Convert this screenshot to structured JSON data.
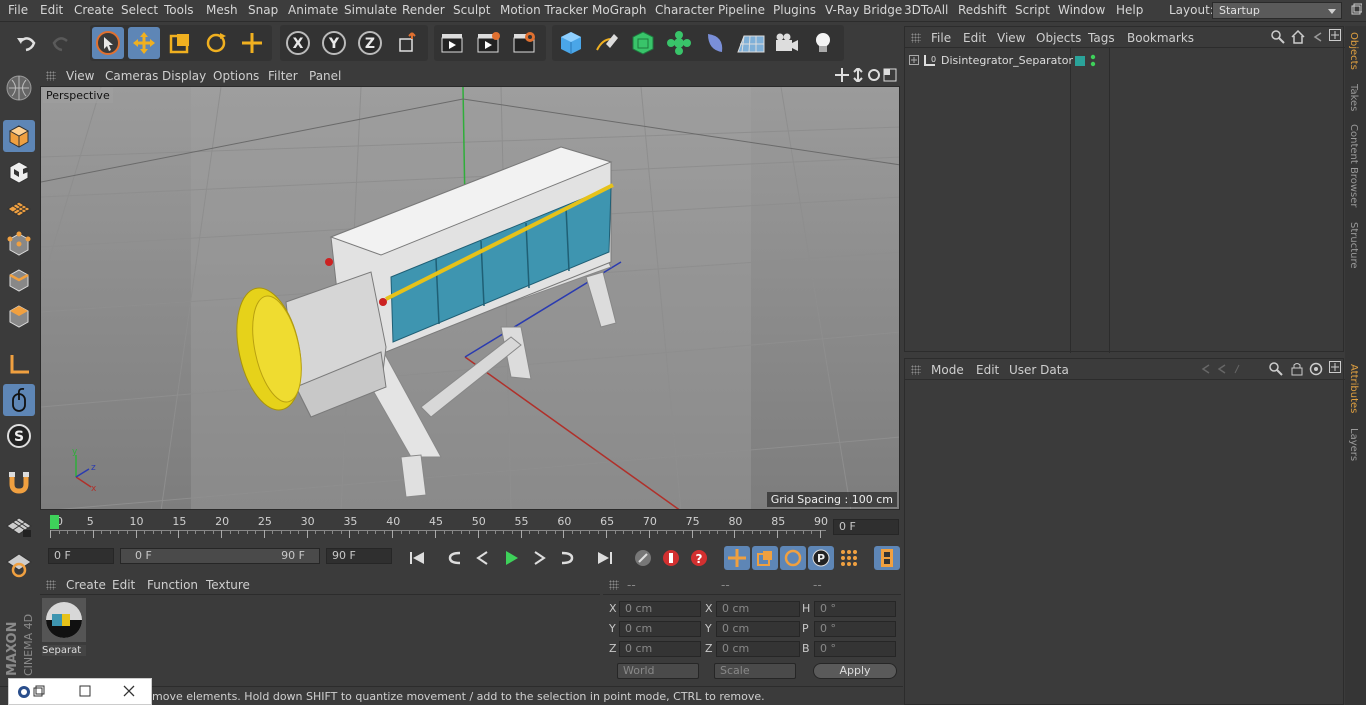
{
  "menubar": {
    "items": [
      "File",
      "Edit",
      "Create",
      "Select",
      "Tools",
      "Mesh",
      "Snap",
      "Animate",
      "Simulate",
      "Render",
      "Sculpt",
      "Motion Tracker",
      "MoGraph",
      "Character",
      "Pipeline",
      "Plugins",
      "V-Ray Bridge",
      "3DToAll",
      "Redshift",
      "Script",
      "Window",
      "Help"
    ],
    "layout_label": "Layout:",
    "layout_value": "Startup"
  },
  "viewport": {
    "menu": [
      "View",
      "Cameras",
      "Display",
      "Options",
      "Filter",
      "Panel"
    ],
    "label": "Perspective",
    "grid_spacing": "Grid Spacing : 100 cm"
  },
  "timeline": {
    "ticks": [
      "0",
      "5",
      "10",
      "15",
      "20",
      "25",
      "30",
      "35",
      "40",
      "45",
      "50",
      "55",
      "60",
      "65",
      "70",
      "75",
      "80",
      "85",
      "90"
    ],
    "current_frame": "0 F"
  },
  "transport": {
    "start_field": "0 F",
    "range_start": "0 F",
    "range_end": "90 F",
    "end_field": "90 F"
  },
  "material_panel": {
    "menu": [
      "Create",
      "Edit",
      "Function",
      "Texture"
    ],
    "material_name": "Separat"
  },
  "coords": {
    "headers": [
      "--",
      "--",
      "--"
    ],
    "rows": [
      {
        "a": "X",
        "av": "0 cm",
        "b": "X",
        "bv": "0 cm",
        "c": "H",
        "cv": "0 °"
      },
      {
        "a": "Y",
        "av": "0 cm",
        "b": "Y",
        "bv": "0 cm",
        "c": "P",
        "cv": "0 °"
      },
      {
        "a": "Z",
        "av": "0 cm",
        "b": "Z",
        "bv": "0 cm",
        "c": "B",
        "cv": "0 °"
      }
    ],
    "world": "World",
    "scale": "Scale",
    "apply": "Apply"
  },
  "status": {
    "text": "move elements. Hold down SHIFT to quantize movement / add to the selection in point mode, CTRL to remove."
  },
  "object_manager": {
    "menu": [
      "File",
      "Edit",
      "View",
      "Objects",
      "Tags",
      "Bookmarks"
    ],
    "object_name": "Disintegrator_Separator",
    "layer_color": "#2aa39a"
  },
  "attributes": {
    "menu": [
      "Mode",
      "Edit",
      "User Data"
    ]
  },
  "right_tabs": [
    "Objects",
    "Takes",
    "Content Browser",
    "Structure",
    "Attributes",
    "Layers"
  ],
  "brand": {
    "line1": "MAXON",
    "line2": "CINEMA 4D"
  },
  "colors": {
    "accent": "#5e86b6",
    "highlight": "#e0a040",
    "play": "#3ed15a"
  }
}
